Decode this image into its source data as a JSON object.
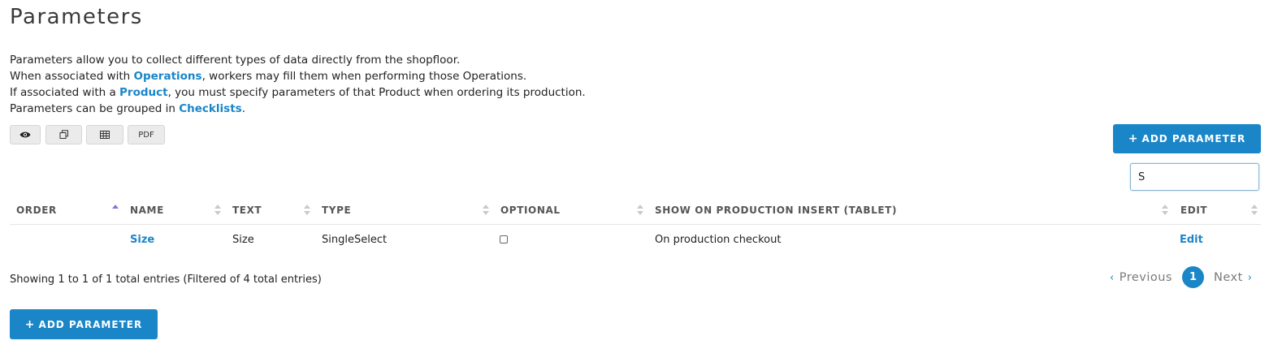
{
  "page": {
    "title": "Parameters"
  },
  "intro": {
    "line1": "Parameters allow you to collect different types of data directly from the shopfloor.",
    "line2_pre": "When associated with ",
    "line2_link": "Operations",
    "line2_post": ", workers may fill them when performing those Operations.",
    "line3_pre": "If associated with a ",
    "line3_link": "Product",
    "line3_post": ", you must specify parameters of that Product when ordering its production.",
    "line4_pre": "Parameters can be grouped in ",
    "line4_link": "Checklists",
    "line4_post": "."
  },
  "toolbar": {
    "icons": [
      "eye-icon",
      "copy-icon",
      "table-icon"
    ],
    "pdf_label": "PDF"
  },
  "actions": {
    "add_label": "ADD PARAMETER",
    "add_icon": "+"
  },
  "search": {
    "value": "S"
  },
  "table": {
    "columns": [
      "ORDER",
      "NAME",
      "TEXT",
      "TYPE",
      "OPTIONAL",
      "SHOW ON PRODUCTION INSERT (TABLET)",
      "EDIT"
    ],
    "sorted_column": "ORDER",
    "sort_direction": "ascending",
    "rows": [
      {
        "order": "",
        "name": "Size",
        "text": "Size",
        "type": "SingleSelect",
        "optional": false,
        "show_on_insert": "On production checkout",
        "edit": "Edit"
      }
    ]
  },
  "footer": {
    "info": "Showing 1 to 1 of 1 total entries (Filtered of 4 total entries)",
    "previous_label": "Previous",
    "next_label": "Next",
    "current_page": "1"
  },
  "colors": {
    "accent": "#1a86c8",
    "sort_active": "#7a7ad8"
  }
}
